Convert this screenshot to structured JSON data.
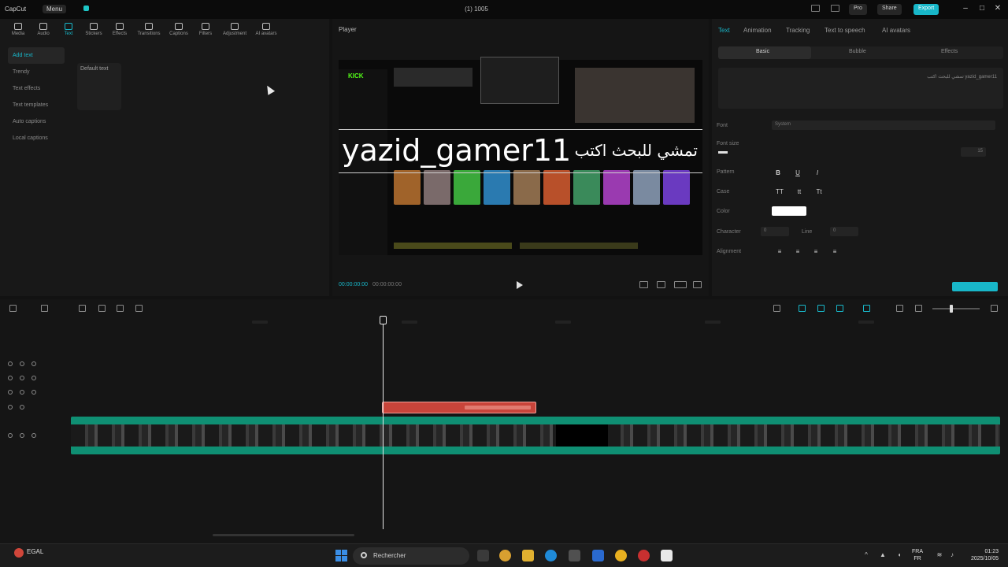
{
  "titlebar": {
    "app_name": "CapCut",
    "menu_label": "Menu",
    "project_label": "",
    "center_title": "(1) 1005",
    "pro_label": "Pro",
    "share_label": "Share",
    "export_label": "Export"
  },
  "toolbar": {
    "items": [
      {
        "label": "Media"
      },
      {
        "label": "Audio"
      },
      {
        "label": "Text"
      },
      {
        "label": "Stickers"
      },
      {
        "label": "Effects"
      },
      {
        "label": "Transitions"
      },
      {
        "label": "Captions"
      },
      {
        "label": "Filters"
      },
      {
        "label": "Adjustment"
      },
      {
        "label": "AI avatars"
      }
    ]
  },
  "sidebar": {
    "items": [
      {
        "label": "Add text"
      },
      {
        "label": "Trendy"
      },
      {
        "label": "Text effects"
      },
      {
        "label": "Text templates"
      },
      {
        "label": "Auto captions"
      },
      {
        "label": "Local captions"
      }
    ]
  },
  "text_panel": {
    "default_text": "Default text"
  },
  "player": {
    "title": "Player",
    "overlay_text_left": "yazid_gamer11",
    "overlay_text_right": "تمشي للبحث اكتب",
    "site_logo": "KICK",
    "timecode": "00:00:00:00",
    "duration": "00:00:00:00"
  },
  "inspector": {
    "tabs": [
      {
        "label": "Text"
      },
      {
        "label": "Animation"
      },
      {
        "label": "Tracking"
      },
      {
        "label": "Text to speech"
      },
      {
        "label": "AI avatars"
      }
    ],
    "subtabs": [
      {
        "label": "Basic"
      },
      {
        "label": "Bubble"
      },
      {
        "label": "Effects"
      }
    ],
    "text_content": "تمشي للبحث اكتب yazid_gamer11",
    "props": {
      "font": "Font",
      "font_value": "System",
      "font_size": "Font size",
      "font_size_value": "15",
      "pattern": "Pattern",
      "case": "Case",
      "color": "Color",
      "character": "Character",
      "character_value": "0",
      "line": "Line",
      "line_value": "0",
      "alignment": "Alignment"
    }
  },
  "timeline": {
    "playhead_position": "00:00"
  },
  "taskbar": {
    "weather_label": "EGAL",
    "weather_sub": "",
    "search_label": "Rechercher",
    "lang_top": "FRA",
    "lang_bottom": "FR",
    "time": "01:23",
    "date": "2025/10/05"
  },
  "colors": {
    "accent": "#18b7c9",
    "text_clip": "#c8443a",
    "video_clip": "#0f8f73",
    "kick_green": "#53fc18"
  }
}
